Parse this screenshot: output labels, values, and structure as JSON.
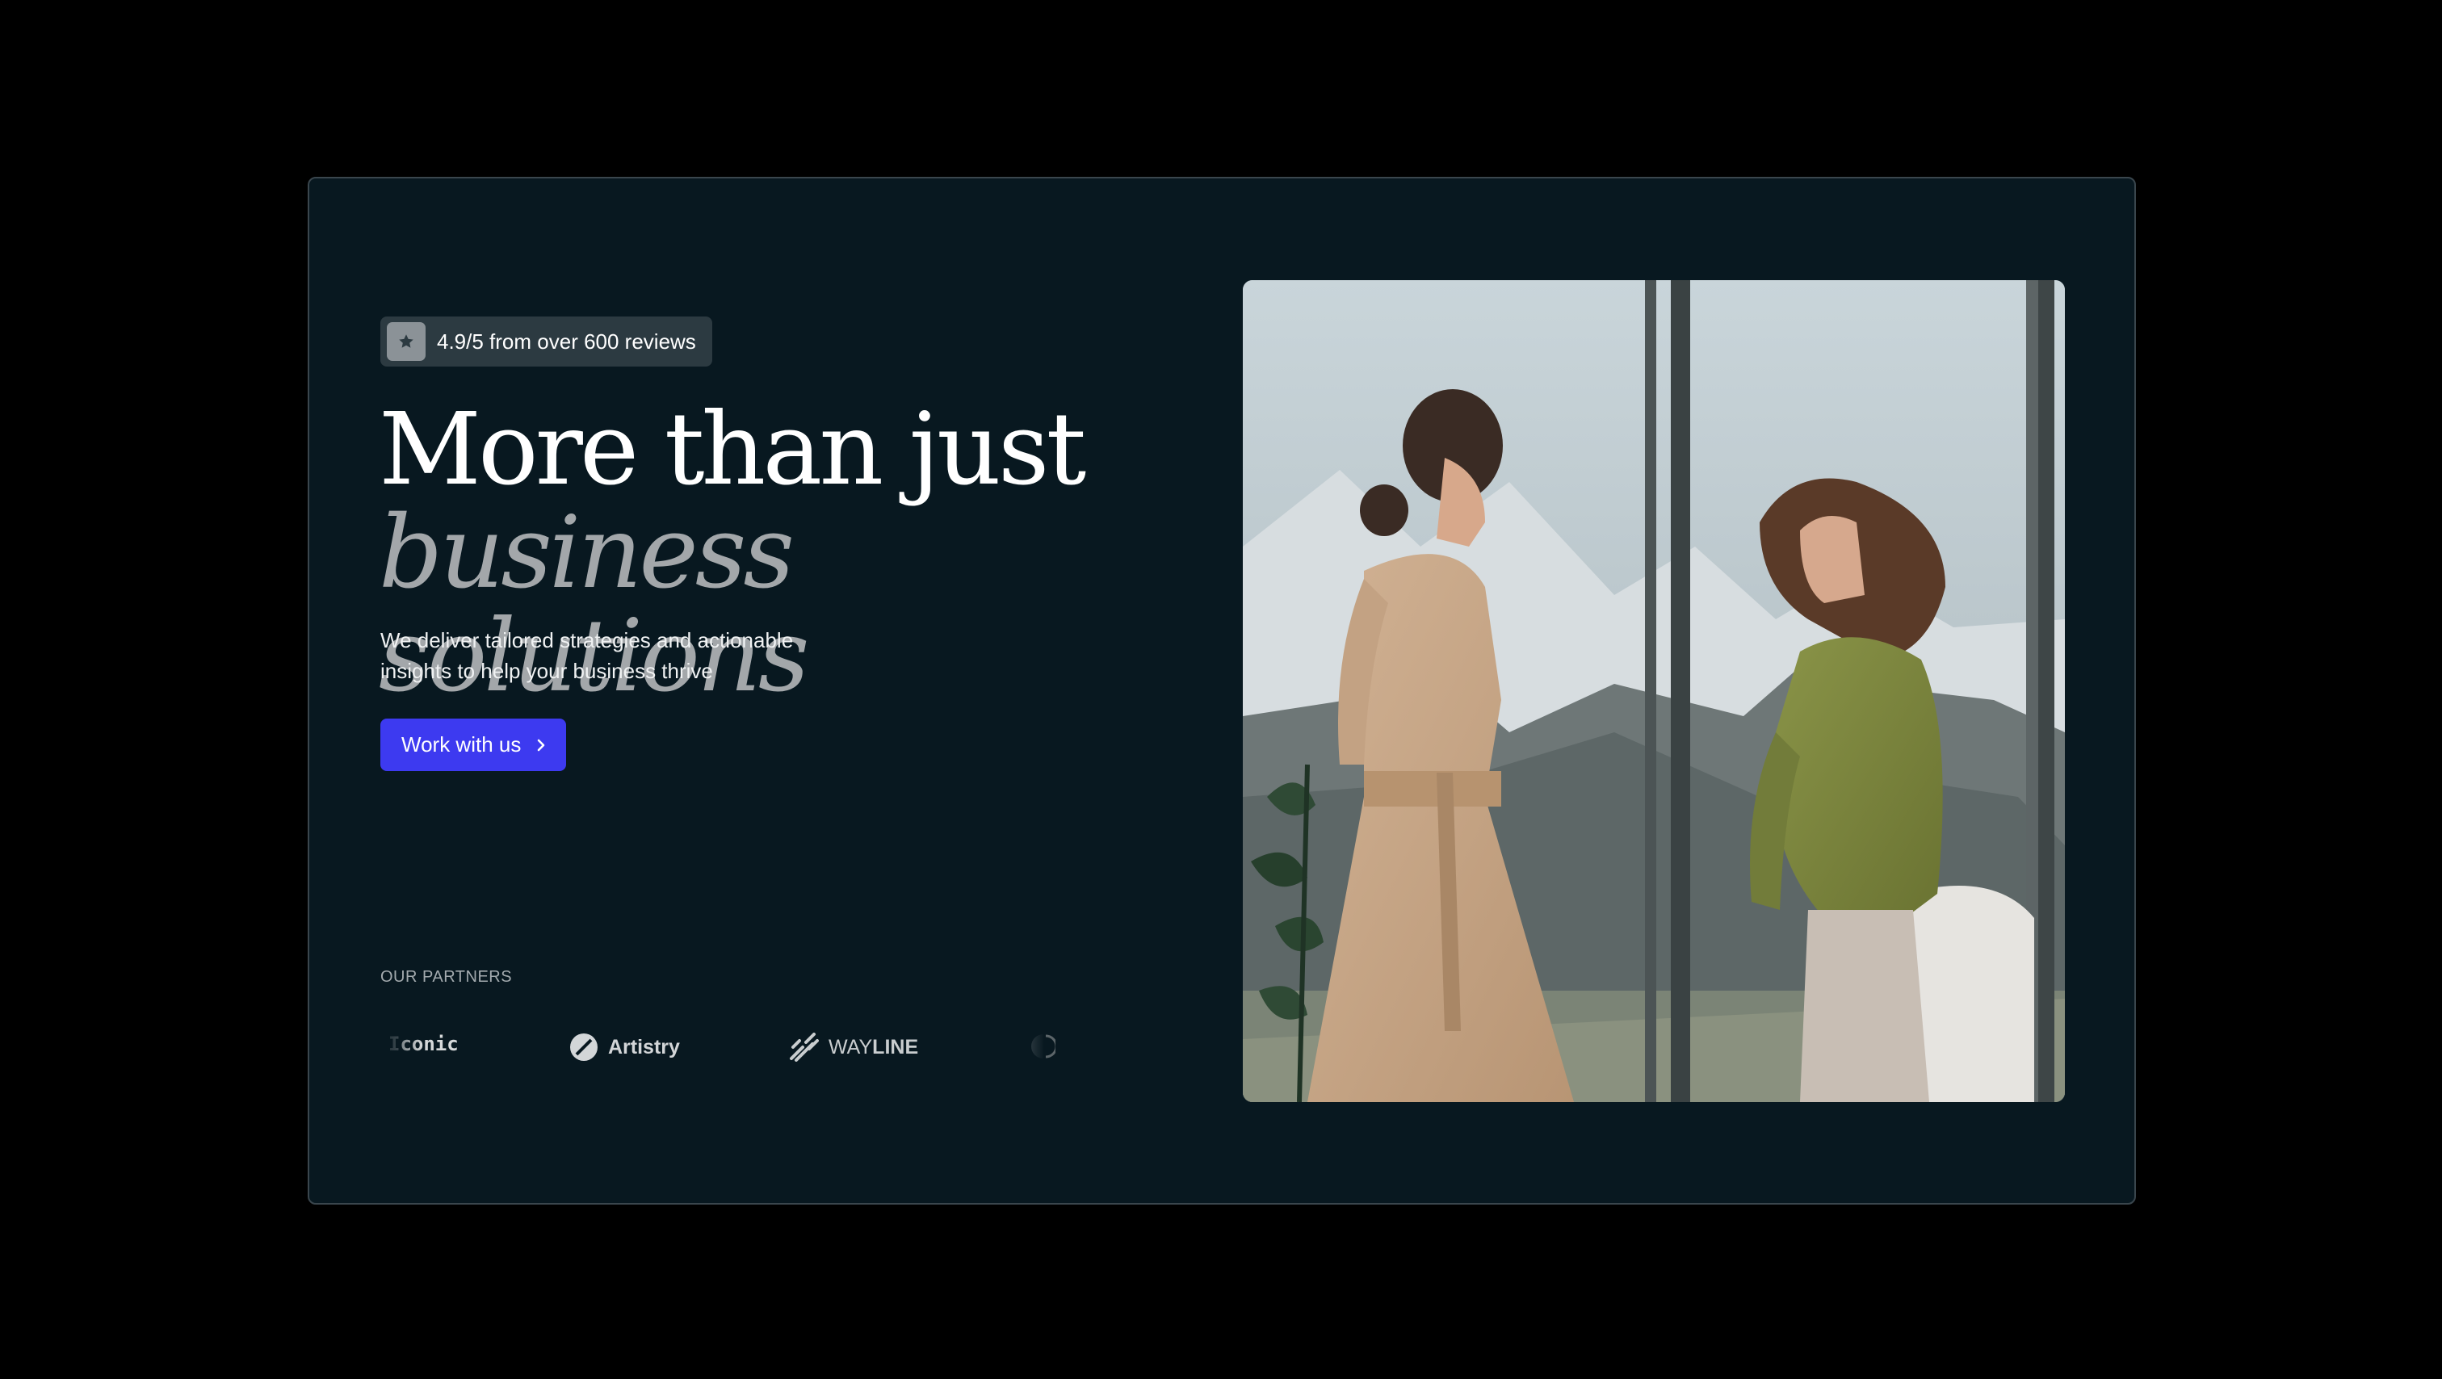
{
  "badge": {
    "icon": "star-icon",
    "text": "4.9/5 from over 600 reviews"
  },
  "hero": {
    "headline_line1": "More than just",
    "headline_line2": "business solutions",
    "subtext_line1": "We deliver tailored strategies and actionable",
    "subtext_line2": "insights to help your business thrive",
    "cta_label": "Work with us",
    "cta_icon": "chevron-right-icon"
  },
  "partners": {
    "label": "OUR PARTNERS",
    "items": [
      {
        "name_prefix": "I",
        "name": "conic"
      },
      {
        "name": "Artistry",
        "icon": "slash-circle-icon"
      },
      {
        "name_prefix": "WAY",
        "name": "LINE",
        "icon": "wayline-icon"
      },
      {
        "icon": "half-circle-icon"
      }
    ]
  },
  "image": {
    "icon": "two-women-talking-photo"
  },
  "colors": {
    "background": "#000000",
    "card": "#081820",
    "accent": "#3d3af0",
    "badge_bg": "#2c3a41",
    "headline_muted": "#a3a7aa"
  }
}
